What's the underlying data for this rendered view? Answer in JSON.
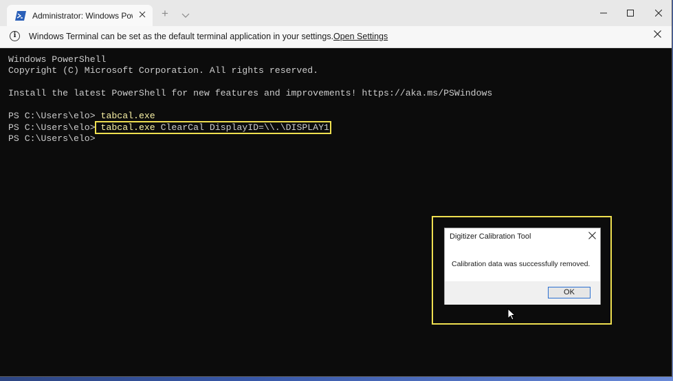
{
  "window": {
    "tab_title": "Administrator: Windows PowerS",
    "new_tab_symbol": "+",
    "tab_icon": "powershell-icon"
  },
  "infobar": {
    "message": "Windows Terminal can be set as the default terminal application in your settings.",
    "link_label": "Open Settings"
  },
  "terminal": {
    "lines": [
      {
        "text": "Windows PowerShell"
      },
      {
        "text": "Copyright (C) Microsoft Corporation. All rights reserved."
      },
      {
        "text": ""
      },
      {
        "text": "Install the latest PowerShell for new features and improvements! https://aka.ms/PSWindows"
      },
      {
        "text": ""
      },
      {
        "prompt": "PS C:\\Users\\elo> ",
        "command": "tabcal.exe",
        "args": ""
      },
      {
        "prompt": "PS C:\\Users\\elo> ",
        "command": "tabcal.exe",
        "args": " ClearCal DisplayID=\\\\.\\DISPLAY1"
      },
      {
        "prompt": "PS C:\\Users\\elo>",
        "command": "",
        "args": ""
      }
    ]
  },
  "dialog": {
    "title": "Digitizer Calibration Tool",
    "message": "Calibration data was successfully removed.",
    "ok_label": "OK"
  },
  "colors": {
    "terminal_bg": "#0c0c0c",
    "terminal_fg": "#cccccc",
    "command_yellow": "#f9f1a5",
    "highlight_yellow": "#f0e050"
  }
}
